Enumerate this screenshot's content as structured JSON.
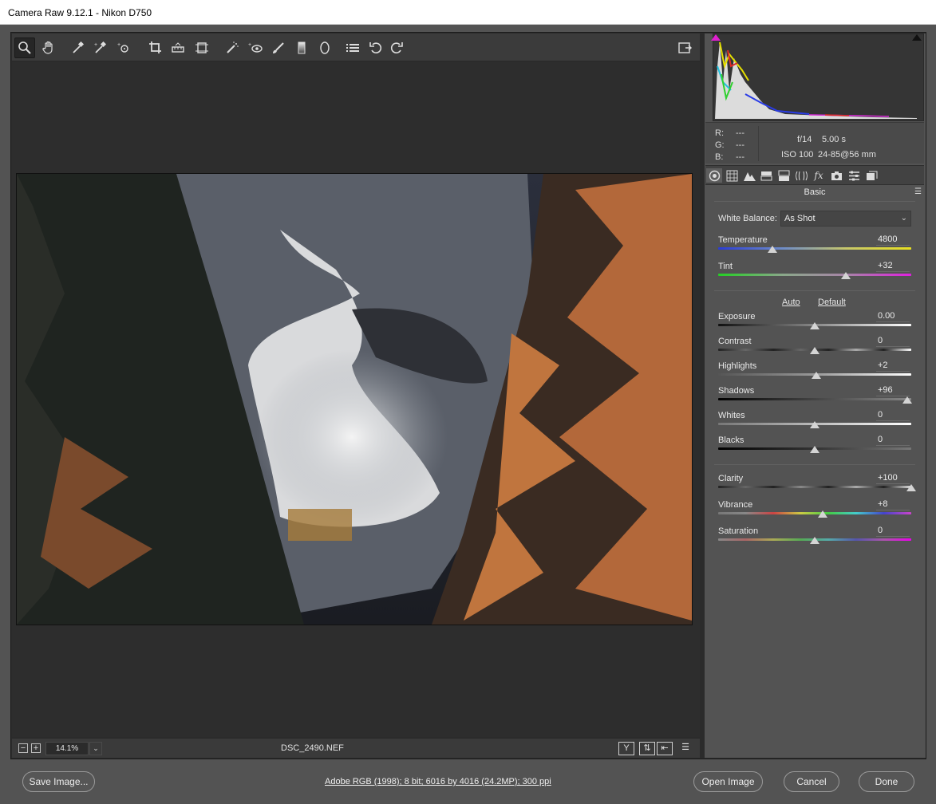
{
  "window": {
    "title": "Camera Raw 9.12.1  -  Nikon D750"
  },
  "toolbar": {
    "tools": [
      {
        "name": "zoom-tool",
        "icon": "magnifier-icon"
      },
      {
        "name": "hand-tool",
        "icon": "hand-icon"
      },
      {
        "name": "white-balance-tool",
        "icon": "eyedropper-icon"
      },
      {
        "name": "color-sampler-tool",
        "icon": "color-sampler-icon"
      },
      {
        "name": "targeted-adjustment-tool",
        "icon": "target-adjust-icon"
      },
      {
        "name": "crop-tool",
        "icon": "crop-icon"
      },
      {
        "name": "straighten-tool",
        "icon": "level-icon"
      },
      {
        "name": "transform-tool",
        "icon": "transform-icon"
      },
      {
        "name": "spot-removal-tool",
        "icon": "spot-removal-icon"
      },
      {
        "name": "red-eye-tool",
        "icon": "red-eye-icon"
      },
      {
        "name": "adjustment-brush-tool",
        "icon": "brush-icon"
      },
      {
        "name": "graduated-filter-tool",
        "icon": "gradient-icon"
      },
      {
        "name": "radial-filter-tool",
        "icon": "ellipse-icon"
      },
      {
        "name": "preferences-tool",
        "icon": "list-icon"
      },
      {
        "name": "rotate-left-tool",
        "icon": "rotate-ccw-icon"
      },
      {
        "name": "rotate-right-tool",
        "icon": "rotate-cw-icon"
      }
    ]
  },
  "readout": {
    "r_label": "R:",
    "g_label": "G:",
    "b_label": "B:",
    "r_value": "---",
    "g_value": "---",
    "b_value": "---",
    "aperture": "f/14",
    "shutter": "5.00 s",
    "iso": "ISO 100",
    "lens": "24-85@56 mm"
  },
  "panel": {
    "section_title": "Basic",
    "white_balance_label": "White Balance:",
    "white_balance_value": "As Shot",
    "auto_label": "Auto",
    "default_label": "Default"
  },
  "sliders": {
    "temperature": {
      "label": "Temperature",
      "value": "4800",
      "position": 0.28
    },
    "tint": {
      "label": "Tint",
      "value": "+32",
      "position": 0.66
    },
    "exposure": {
      "label": "Exposure",
      "value": "0.00",
      "position": 0.5
    },
    "contrast": {
      "label": "Contrast",
      "value": "0",
      "position": 0.5
    },
    "highlights": {
      "label": "Highlights",
      "value": "+2",
      "position": 0.51
    },
    "shadows": {
      "label": "Shadows",
      "value": "+96",
      "position": 0.98
    },
    "whites": {
      "label": "Whites",
      "value": "0",
      "position": 0.5
    },
    "blacks": {
      "label": "Blacks",
      "value": "0",
      "position": 0.5
    },
    "clarity": {
      "label": "Clarity",
      "value": "+100",
      "position": 1.0
    },
    "vibrance": {
      "label": "Vibrance",
      "value": "+8",
      "position": 0.54
    },
    "saturation": {
      "label": "Saturation",
      "value": "0",
      "position": 0.5
    }
  },
  "status": {
    "zoom": "14.1%",
    "filename": "DSC_2490.NEF",
    "zoom_out": "−",
    "zoom_in": "+",
    "y_toggle": "Y"
  },
  "footer": {
    "save_label": "Save Image...",
    "workflow_options": "Adobe RGB (1998); 8 bit; 6016 by 4016 (24.2MP); 300 ppi",
    "open_label": "Open Image",
    "cancel_label": "Cancel",
    "done_label": "Done"
  },
  "colors": {
    "accent": "#2d2d2d",
    "panel": "#535353",
    "clip_shadow": "#e020d0"
  }
}
